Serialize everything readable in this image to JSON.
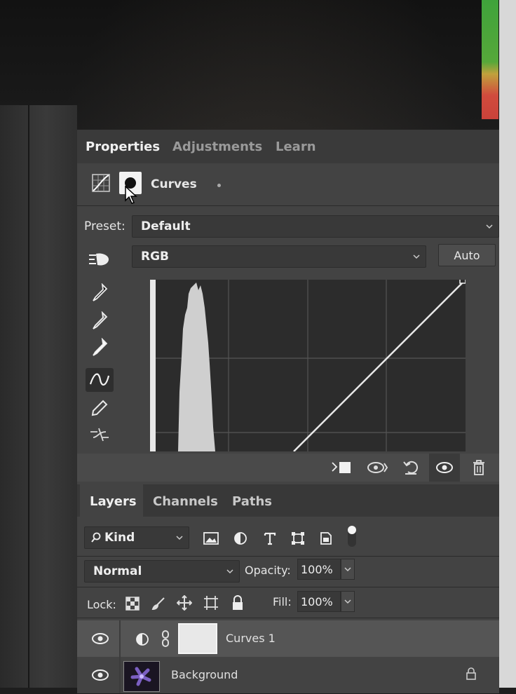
{
  "properties_panel": {
    "tabs": [
      {
        "label": "Properties",
        "active": true
      },
      {
        "label": "Adjustments",
        "active": false
      },
      {
        "label": "Learn",
        "active": false
      }
    ],
    "adjustment_title": "Curves",
    "preset_label": "Preset:",
    "preset_value": "Default",
    "channel_value": "RGB",
    "auto_label": "Auto",
    "tools": [
      "sample-in-image-black-point",
      "sample-in-image-gray-point",
      "sample-in-image-white-point",
      "edit-points-curve",
      "draw-curve",
      "smooth-curve"
    ],
    "bottom_icons": [
      "clip-to-layer-icon",
      "view-previous-state-icon",
      "reset-icon",
      "visibility-icon",
      "delete-icon"
    ]
  },
  "layers_panel": {
    "tabs": [
      {
        "label": "Layers",
        "active": true
      },
      {
        "label": "Channels",
        "active": false
      },
      {
        "label": "Paths",
        "active": false
      }
    ],
    "filter_kind": "Kind",
    "blend_mode": "Normal",
    "opacity_label": "Opacity:",
    "opacity_value": "100%",
    "lock_label": "Lock:",
    "fill_label": "Fill:",
    "fill_value": "100%",
    "layers": [
      {
        "name": "Curves 1",
        "visible": true,
        "selected": true
      },
      {
        "name": "Background",
        "visible": true,
        "locked": true
      }
    ]
  },
  "colors": {
    "panel_bg": "#434343",
    "tab_bar_bg": "#3a3a3a",
    "text_active": "#f0f0f0",
    "text_inactive": "#9a9a9a"
  }
}
